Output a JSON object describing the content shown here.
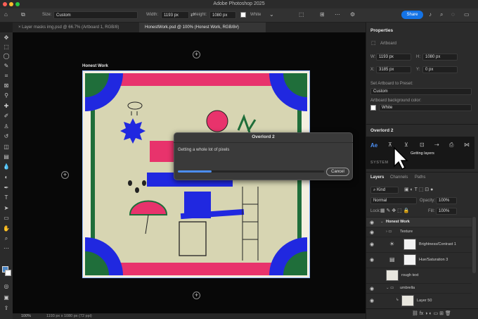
{
  "app": {
    "title": "Adobe Photoshop 2025",
    "share_label": "Share"
  },
  "options_bar": {
    "size_label": "Size:",
    "size_value": "Custom",
    "width_label": "Width:",
    "width_value": "1193 px",
    "height_label": "Height:",
    "height_value": "1080 px",
    "color_value": "White"
  },
  "tabs": [
    {
      "label": "Layer masks img.psd @ 66.7% (Artboard 1, RGB/8)"
    },
    {
      "label": "HonestWork.psd @ 100% (Honest Work, RGB/8#)"
    }
  ],
  "canvas": {
    "artboard_label": "Honest Work"
  },
  "dialog": {
    "title": "Overlord 2",
    "message": "Getting a whole lot of pixels",
    "cancel_label": "Cancel",
    "progress": 0.23
  },
  "status": {
    "zoom": "100%",
    "doc_info": "1193 px x 1080 px (72 ppi)"
  },
  "properties": {
    "header": "Properties",
    "type_label": "Artboard",
    "w_label": "W:",
    "w_value": "1193 px",
    "h_label": "H:",
    "h_value": "1080 px",
    "x_label": "X:",
    "x_value": "3185 px",
    "y_label": "Y:",
    "y_value": "0 px",
    "preset_label": "Set Artboard to Preset:",
    "preset_value": "Custom",
    "bg_label": "Artboard background color:",
    "bg_value": "White"
  },
  "overlord": {
    "header": "Overlord 2",
    "tooltip": "Getting layers",
    "system_label": "SYSTEM"
  },
  "layers_panel": {
    "tabs": [
      "Layers",
      "Channels",
      "Paths"
    ],
    "kind_label": "Kind",
    "blend_mode": "Normal",
    "opacity_label": "Opacity:",
    "opacity_value": "100%",
    "lock_label": "Lock:",
    "fill_label": "Fill:",
    "fill_value": "100%",
    "layers": [
      {
        "name": "Honest Work"
      },
      {
        "name": "Texture"
      },
      {
        "name": "Brightness/Contrast 1"
      },
      {
        "name": "Hue/Saturation 3"
      },
      {
        "name": "rough text"
      },
      {
        "name": "umbrella"
      },
      {
        "name": "Layer 50"
      }
    ]
  },
  "colors": {
    "accent_blue": "#1473e6",
    "art_bg": "#d7d5b2",
    "art_green": "#1f6e3a",
    "art_pink": "#e8336c",
    "art_blue": "#2028e0",
    "art_cream": "#f4efe0"
  }
}
